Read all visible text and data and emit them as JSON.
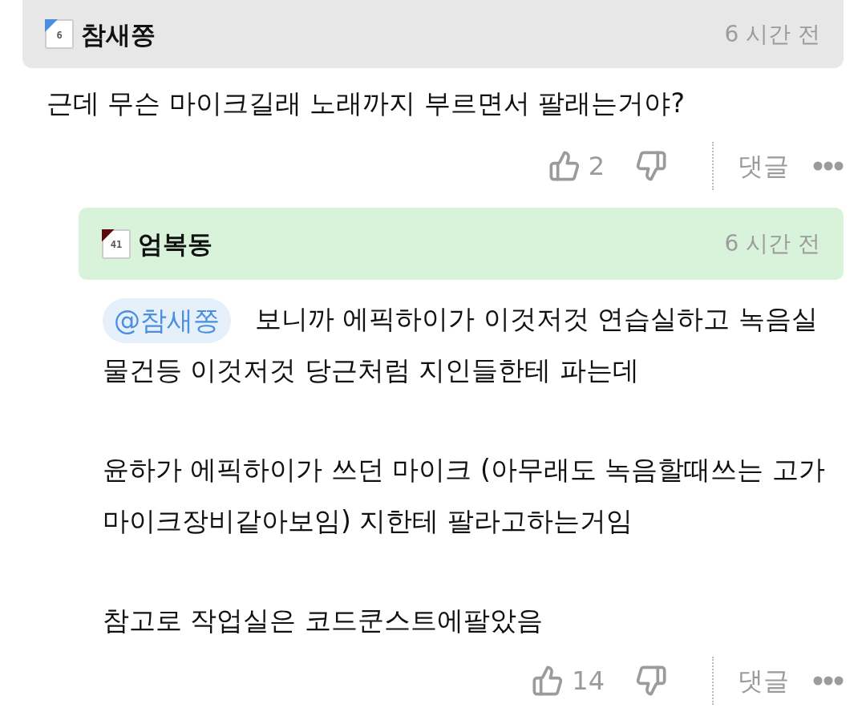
{
  "comments": [
    {
      "author": {
        "name": "참새쫑",
        "level": "6",
        "color": "#4a8fdf"
      },
      "time": "6 시간 전",
      "paragraphs": [
        "근데 무슨 마이크길래 노래까지 부르면서 팔래는거야?"
      ],
      "likes": "2",
      "reply_label": "댓글",
      "replies": [
        {
          "author": {
            "name": "엄복동",
            "level": "41",
            "color": "#5c0a0a"
          },
          "time": "6 시간 전",
          "mention": "@참새쫑",
          "paragraphs": [
            "보니까 에픽하이가 이것저것 연습실하고 녹음실 물건등 이것저것 당근처럼 지인들한테 파는데",
            "윤하가 에픽하이가 쓰던 마이크 (아무래도 녹음할때쓰는 고가 마이크장비같아보임) 지한테 팔라고하는거임",
            "참고로 작업실은 코드쿤스트에팔았음"
          ],
          "likes": "14",
          "reply_label": "댓글"
        }
      ]
    }
  ]
}
